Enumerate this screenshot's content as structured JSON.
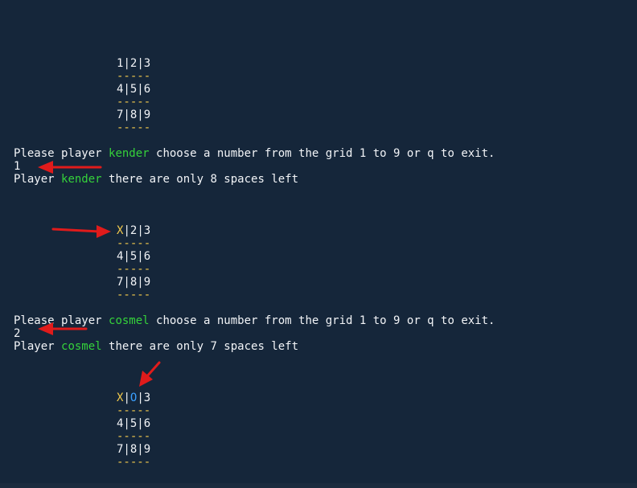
{
  "theme": {
    "background": "#15263a",
    "text": "#f2f4f7",
    "player_name": "#35d23a",
    "separator": "#f2c94c",
    "x_mark": "#f2c94c",
    "o_mark": "#3aa0ff",
    "arrow": "#e01b1b"
  },
  "board1": {
    "row1": {
      "c1": "1",
      "s1": "|",
      "c2": "2",
      "s2": "|",
      "c3": "3"
    },
    "div1": "-----",
    "row2": "4|5|6",
    "div2": "-----",
    "row3": "7|8|9",
    "div3": "-----"
  },
  "turn1": {
    "prompt_pre": "Please player ",
    "player": "kender",
    "prompt_post": " choose a number from the grid 1 to 9 or q to exit.",
    "input": "1",
    "status_pre": "Player ",
    "status_post": " there are only 8 spaces left"
  },
  "board2": {
    "row1": {
      "c1": "X",
      "s1": "|",
      "c2": "2",
      "s2": "|",
      "c3": "3"
    },
    "div1": "-----",
    "row2": "4|5|6",
    "div2": "-----",
    "row3": "7|8|9",
    "div3": "-----"
  },
  "turn2": {
    "prompt_pre": "Please player ",
    "player": "cosmel",
    "prompt_post": " choose a number from the grid 1 to 9 or q to exit.",
    "input": "2",
    "status_pre": "Player ",
    "status_post": " there are only 7 spaces left"
  },
  "board3": {
    "row1": {
      "c1": "X",
      "s1": "|",
      "c2": "O",
      "s2": "|",
      "c3": "3"
    },
    "div1": "-----",
    "row2": "4|5|6",
    "div2": "-----",
    "row3": "7|8|9",
    "div3": "-----"
  }
}
